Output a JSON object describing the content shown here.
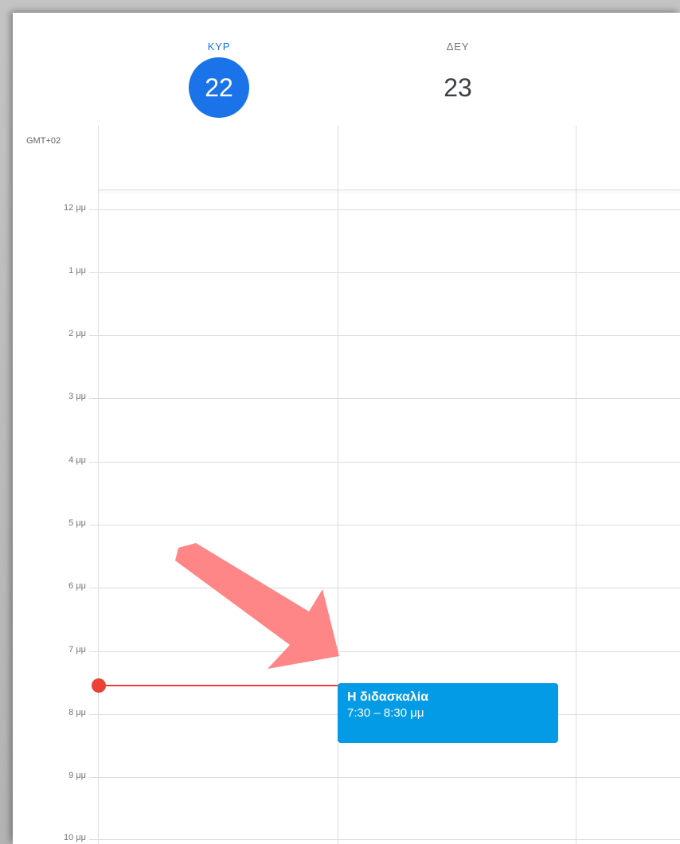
{
  "columns": [
    {
      "day_name": "ΚΥΡ",
      "day_number": "22",
      "is_today": true
    },
    {
      "day_name": "ΔΕΥ",
      "day_number": "23",
      "is_today": false
    }
  ],
  "timezone": "GMT+02",
  "hours": [
    "12 μμ",
    "1 μμ",
    "2 μμ",
    "3 μμ",
    "4 μμ",
    "5 μμ",
    "6 μμ",
    "7 μμ",
    "8 μμ",
    "9 μμ",
    "10 μμ"
  ],
  "event": {
    "title": "Η διδασκαλία",
    "time": "7:30 – 8:30 μμ",
    "color": "#039be5"
  },
  "colors": {
    "today_accent": "#1a73e8",
    "now_indicator": "#ea4335",
    "annotation_arrow": "#ff8080"
  }
}
